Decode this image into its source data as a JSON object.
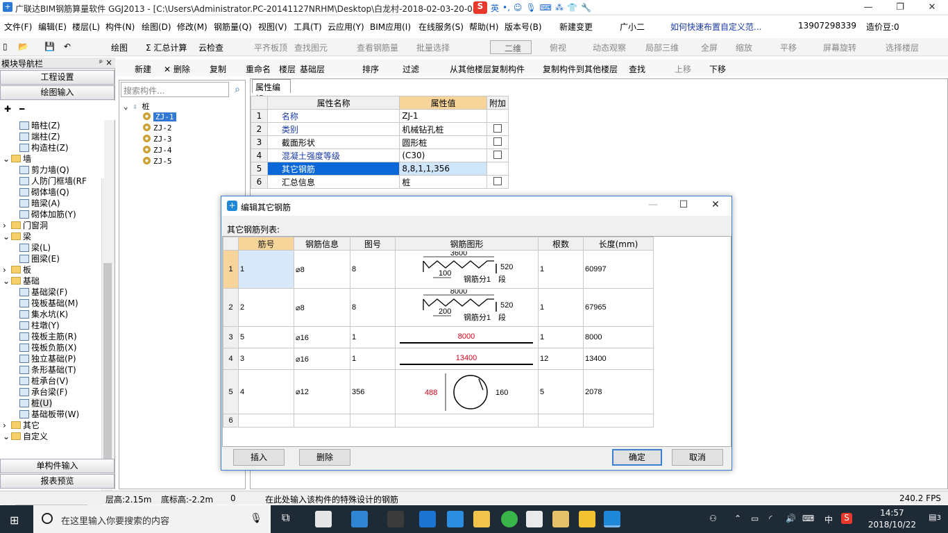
{
  "window": {
    "title": "广联达BIM钢筋算量软件 GGJ2013 - [C:\\Users\\Administrator.PC-20141127NRHM\\Desktop\\白龙村-2018-02-03-20-08",
    "ime_badge": "81",
    "ime_lang": "英",
    "min": "—",
    "restore": "❐",
    "close": "✕"
  },
  "menu": [
    "文件(F)",
    "编辑(E)",
    "楼层(L)",
    "构件(N)",
    "绘图(D)",
    "修改(M)",
    "钢筋量(Q)",
    "视图(V)",
    "工具(T)",
    "云应用(Y)",
    "BIM应用(I)",
    "在线服务(S)",
    "帮助(H)",
    "版本号(B)",
    "新建变更",
    "广小二",
    "如何快速布置自定义范...",
    "13907298339",
    "造价豆:0"
  ],
  "toolbar1": {
    "draw": "绘图",
    "sum": "汇总计算",
    "cloud_check": "云检查",
    "flat_top": "平齐板顶",
    "find": "查找图元",
    "view_rebar": "查看钢筋量",
    "batch": "批量选择",
    "view_mode": "二维",
    "top_view": "俯视",
    "dynamic": "动态观察",
    "local3d": "局部三维",
    "fullscreen": "全屏",
    "zoom": "缩放",
    "pan": "平移",
    "rotate": "屏幕旋转",
    "select_floor": "选择楼层"
  },
  "toolbar2": {
    "new": "新建",
    "delete": "删除",
    "copy": "复制",
    "rename": "重命名",
    "floor_label": "楼层",
    "floor_value": "基础层",
    "sort": "排序",
    "filter": "过滤",
    "copy_from": "从其他楼层复制构件",
    "copy_to": "复制构件到其他楼层",
    "find": "查找",
    "up": "上移",
    "down": "下移"
  },
  "nav": {
    "header": "模块导航栏",
    "pin": "ᵖ ×",
    "project_settings": "工程设置",
    "drawing_input": "绘图输入",
    "single_input": "单构件输入",
    "report": "报表预览",
    "tree": [
      {
        "label": "暗柱(Z)",
        "indent": 3,
        "type": "item"
      },
      {
        "label": "端柱(Z)",
        "indent": 3,
        "type": "item"
      },
      {
        "label": "构造柱(Z)",
        "indent": 3,
        "type": "item"
      },
      {
        "label": "墙",
        "indent": 1,
        "type": "folder",
        "exp": "⌄"
      },
      {
        "label": "剪力墙(Q)",
        "indent": 3,
        "type": "item"
      },
      {
        "label": "人防门框墙(RF",
        "indent": 3,
        "type": "item"
      },
      {
        "label": "砌体墙(Q)",
        "indent": 3,
        "type": "item"
      },
      {
        "label": "暗梁(A)",
        "indent": 3,
        "type": "item"
      },
      {
        "label": "砌体加筋(Y)",
        "indent": 3,
        "type": "item"
      },
      {
        "label": "门窗洞",
        "indent": 1,
        "type": "folder",
        "exp": "›"
      },
      {
        "label": "梁",
        "indent": 1,
        "type": "folder",
        "exp": "⌄"
      },
      {
        "label": "梁(L)",
        "indent": 3,
        "type": "item"
      },
      {
        "label": "圈梁(E)",
        "indent": 3,
        "type": "item"
      },
      {
        "label": "板",
        "indent": 1,
        "type": "folder",
        "exp": "›"
      },
      {
        "label": "基础",
        "indent": 1,
        "type": "folder",
        "exp": "⌄"
      },
      {
        "label": "基础梁(F)",
        "indent": 3,
        "type": "item"
      },
      {
        "label": "筏板基础(M)",
        "indent": 3,
        "type": "item"
      },
      {
        "label": "集水坑(K)",
        "indent": 3,
        "type": "item"
      },
      {
        "label": "柱墩(Y)",
        "indent": 3,
        "type": "item"
      },
      {
        "label": "筏板主筋(R)",
        "indent": 3,
        "type": "item"
      },
      {
        "label": "筏板负筋(X)",
        "indent": 3,
        "type": "item"
      },
      {
        "label": "独立基础(P)",
        "indent": 3,
        "type": "item"
      },
      {
        "label": "条形基础(T)",
        "indent": 3,
        "type": "item"
      },
      {
        "label": "桩承台(V)",
        "indent": 3,
        "type": "item"
      },
      {
        "label": "承台梁(F)",
        "indent": 3,
        "type": "item"
      },
      {
        "label": "桩(U)",
        "indent": 3,
        "type": "item",
        "selected": true
      },
      {
        "label": "基础板带(W)",
        "indent": 3,
        "type": "item"
      },
      {
        "label": "其它",
        "indent": 1,
        "type": "folder",
        "exp": "›"
      },
      {
        "label": "自定义",
        "indent": 1,
        "type": "folder",
        "exp": "⌄"
      }
    ]
  },
  "component_list": {
    "search_placeholder": "搜索构件...",
    "root": "桩",
    "items": [
      "ZJ-1",
      "ZJ-2",
      "ZJ-3",
      "ZJ-4",
      "ZJ-5"
    ],
    "selected": 0
  },
  "properties": {
    "tab": "属性编辑",
    "headers": [
      "属性名称",
      "属性值",
      "附加"
    ],
    "rows": [
      {
        "n": "1",
        "name": "名称",
        "value": "ZJ-1",
        "link": true,
        "chk": false
      },
      {
        "n": "2",
        "name": "类别",
        "value": "机械钻孔桩",
        "link": true,
        "chk": true
      },
      {
        "n": "3",
        "name": "截面形状",
        "value": "圆形桩",
        "link": false,
        "chk": true
      },
      {
        "n": "4",
        "name": "混凝土强度等级",
        "value": "(C30)",
        "link": true,
        "chk": true
      },
      {
        "n": "5",
        "name": "其它钢筋",
        "value": "8,8,1,1,356",
        "link": false,
        "chk": false,
        "selected": true
      },
      {
        "n": "6",
        "name": "汇总信息",
        "value": "桩",
        "link": false,
        "chk": true
      }
    ]
  },
  "dialog": {
    "title": "编辑其它钢筋",
    "list_label": "其它钢筋列表:",
    "headers": [
      "筋号",
      "钢筋信息",
      "图号",
      "钢筋图形",
      "根数",
      "长度(mm)"
    ],
    "rows": [
      {
        "n": "1",
        "bar_no": "1",
        "info": "⌀8",
        "fig": "8",
        "count": "1",
        "length": "60997",
        "shape": "zigzag",
        "dims": {
          "top": "3600",
          "left": "100",
          "right": "520",
          "label": "钢筋分1",
          "seg": "段"
        }
      },
      {
        "n": "2",
        "bar_no": "2",
        "info": "⌀8",
        "fig": "8",
        "count": "1",
        "length": "67965",
        "shape": "zigzag",
        "dims": {
          "top": "8000",
          "left": "200",
          "right": "520",
          "label": "钢筋分1",
          "seg": "段"
        }
      },
      {
        "n": "3",
        "bar_no": "5",
        "info": "⌀16",
        "fig": "1",
        "count": "1",
        "length": "8000",
        "shape": "line",
        "dims": {
          "top": "8000"
        }
      },
      {
        "n": "4",
        "bar_no": "3",
        "info": "⌀16",
        "fig": "1",
        "count": "12",
        "length": "13400",
        "shape": "line",
        "dims": {
          "top": "13400"
        }
      },
      {
        "n": "5",
        "bar_no": "4",
        "info": "⌀12",
        "fig": "356",
        "count": "5",
        "length": "2078",
        "shape": "circle",
        "dims": {
          "left": "488",
          "right": "160"
        }
      },
      {
        "n": "6",
        "bar_no": "",
        "info": "",
        "fig": "",
        "count": "",
        "length": "",
        "shape": "none",
        "dims": {}
      }
    ],
    "btn_insert": "插入",
    "btn_delete": "删除",
    "btn_ok": "确定",
    "btn_cancel": "取消"
  },
  "status": {
    "floor_height": "层高:2.15m",
    "base_height": "底标高:-2.2m",
    "zero": "0",
    "hint": "在此处输入该构件的特殊设计的钢筋",
    "fps": "240.2 FPS"
  },
  "taskbar": {
    "search_placeholder": "在这里输入你要搜索的内容",
    "time": "14:57",
    "date": "2018/10/22",
    "lang": "中",
    "notif": "3"
  },
  "colors": {
    "accent": "#3378d4",
    "header_highlight": "#f7d59a",
    "red_dim": "#d0021b"
  }
}
